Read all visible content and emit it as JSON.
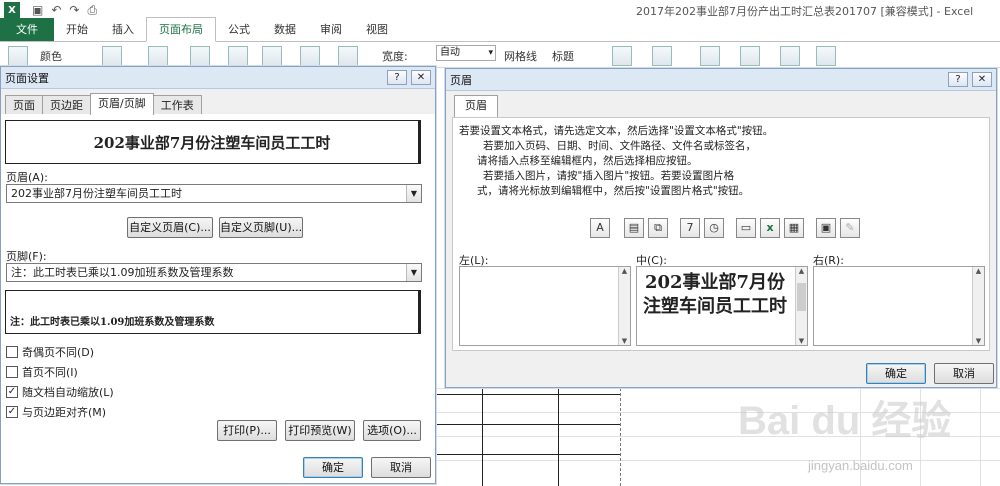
{
  "excel": {
    "title": "2017年202事业部7月份产出工时汇总表201707  [兼容模式] - Excel",
    "logo": "X",
    "tabs": [
      "文件",
      "开始",
      "插入",
      "页面布局",
      "公式",
      "数据",
      "审阅",
      "视图"
    ],
    "active_tab": "页面布局",
    "ribbon": {
      "color_label": "颜色",
      "width_label": "宽度:",
      "width_value": "自动",
      "gridlines_label": "网格线",
      "headings_label": "标题"
    }
  },
  "page_setup": {
    "title": "页面设置",
    "help": "?",
    "close": "✕",
    "tabs": [
      "页面",
      "页边距",
      "页眉/页脚",
      "工作表"
    ],
    "active_tab": "页眉/页脚",
    "header_preview": "202事业部7月份注塑车间员工工时",
    "header_label": "页眉(A):",
    "header_value": "202事业部7月份注塑车间员工工时",
    "custom_header": "自定义页眉(C)...",
    "custom_footer": "自定义页脚(U)...",
    "footer_label": "页脚(F):",
    "footer_value": "注：此工时表已乘以1.09加班系数及管理系数",
    "footer_preview": "注：此工时表已乘以1.09加班系数及管理系数",
    "options": [
      {
        "label": "奇偶页不同(D)",
        "checked": false
      },
      {
        "label": "首页不同(I)",
        "checked": false
      },
      {
        "label": "随文档自动缩放(L)",
        "checked": true
      },
      {
        "label": "与页边距对齐(M)",
        "checked": true
      }
    ],
    "print": "打印(P)...",
    "print_preview": "打印预览(W)",
    "options_btn": "选项(O)...",
    "ok": "确定",
    "cancel": "取消"
  },
  "header_dialog": {
    "title": "页眉",
    "help": "?",
    "close": "✕",
    "tab": "页眉",
    "instructions": [
      "若要设置文本格式，请先选定文本，然后选择\"设置文本格式\"按钮。",
      "若要加入页码、日期、时间、文件路径、文件名或标签名，",
      "请将插入点移至编辑框内，然后选择相应按钮。",
      "若要插入图片，请按\"插入图片\"按钮。若要设置图片格",
      "式，请将光标放到编辑框中，然后按\"设置图片格式\"按钮。"
    ],
    "toolbar_icons": [
      "format-text-icon",
      "page-number-icon",
      "page-count-icon",
      "date-icon",
      "time-icon",
      "file-path-icon",
      "file-name-icon",
      "sheet-name-icon",
      "insert-picture-icon",
      "format-picture-icon"
    ],
    "left_label": "左(L):",
    "center_label": "中(C):",
    "right_label": "右(R):",
    "center_text": "202事业部7月份注塑车间员工工时",
    "ok": "确定",
    "cancel": "取消"
  },
  "watermark": {
    "main": "Bai du 经验",
    "sub": "jingyan.baidu.com"
  }
}
